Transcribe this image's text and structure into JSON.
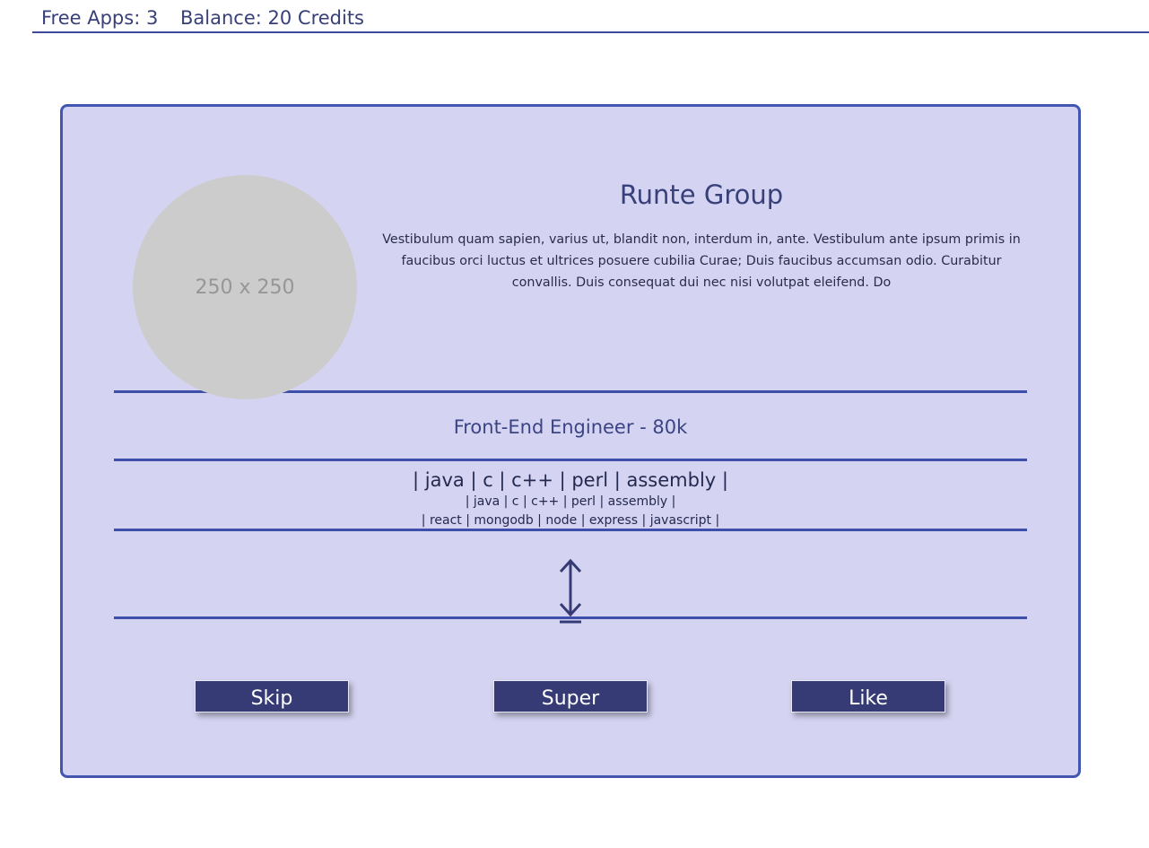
{
  "header": {
    "free_apps": "Free Apps: 3",
    "balance": "Balance: 20 Credits"
  },
  "card": {
    "logo_placeholder": "250 x 250",
    "company_name": "Runte Group",
    "company_description": "Vestibulum quam sapien, varius ut, blandit non, interdum in, ante. Vestibulum ante ipsum primis in faucibus orci luctus et ultrices posuere cubilia Curae; Duis faucibus accumsan odio. Curabitur convallis. Duis consequat dui nec nisi volutpat eleifend. Do",
    "job_title": "Front-End Engineer - 80k",
    "skills_primary": "| java | c | c++ | perl | assembly |",
    "skills_secondary": "| java | c | c++ | perl | assembly |",
    "skills_tertiary": "| react | mongodb | node | express | javascript |",
    "expand_icon": "vertical-expand-arrow-icon"
  },
  "actions": {
    "skip_label": "Skip",
    "super_label": "Super",
    "like_label": "Like"
  },
  "colors": {
    "accent": "#3d4fa8",
    "card_background": "#d4d4f2",
    "button_background": "#363b75",
    "text": "#38407a"
  }
}
